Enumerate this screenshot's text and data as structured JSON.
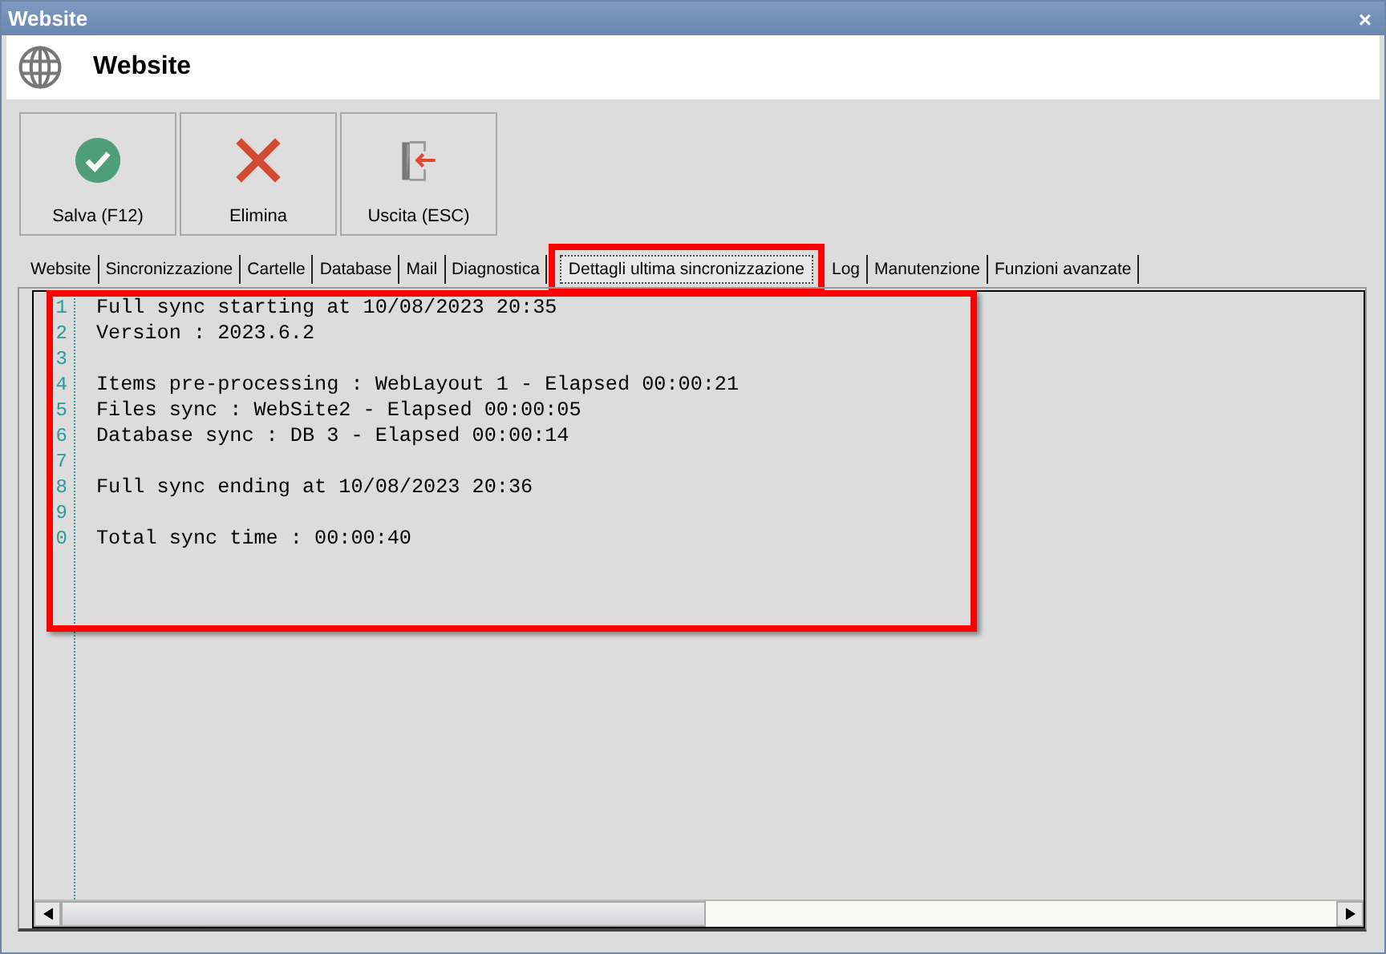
{
  "window": {
    "title": "Website",
    "close": "×"
  },
  "header": {
    "title": "Website"
  },
  "toolbar": [
    {
      "label": "Salva (F12)",
      "kind": "save"
    },
    {
      "label": "Elimina",
      "kind": "delete"
    },
    {
      "label": "Uscita (ESC)",
      "kind": "exit"
    }
  ],
  "tabs": [
    {
      "label": "Website",
      "selected": false
    },
    {
      "label": "Sincronizzazione",
      "selected": false
    },
    {
      "label": "Cartelle",
      "selected": false
    },
    {
      "label": "Database",
      "selected": false
    },
    {
      "label": "Mail",
      "selected": false
    },
    {
      "label": "Diagnostica",
      "selected": false
    },
    {
      "label": "Dettagli ultima sincronizzazione",
      "selected": true
    },
    {
      "label": "Log",
      "selected": false
    },
    {
      "label": "Manutenzione",
      "selected": false
    },
    {
      "label": "Funzioni avanzate",
      "selected": false
    }
  ],
  "editor": {
    "lines": [
      {
        "number": "1",
        "text": "Full sync starting at 10/08/2023 20:35"
      },
      {
        "number": "2",
        "text": "Version : 2023.6.2"
      },
      {
        "number": "3"
      },
      {
        "number": "4",
        "text": "Items pre-processing : WebLayout 1 - Elapsed 00:00:21"
      },
      {
        "number": "5",
        "text": "Files sync : WebSite2 - Elapsed 00:00:05"
      },
      {
        "number": "6",
        "text": "Database sync : DB 3 - Elapsed 00:00:14"
      },
      {
        "number": "7"
      },
      {
        "number": "8",
        "text": "Full sync ending at 10/08/2023 20:36"
      },
      {
        "number": "9"
      },
      {
        "number": "0",
        "text": "Total sync time : 00:00:40"
      }
    ]
  }
}
